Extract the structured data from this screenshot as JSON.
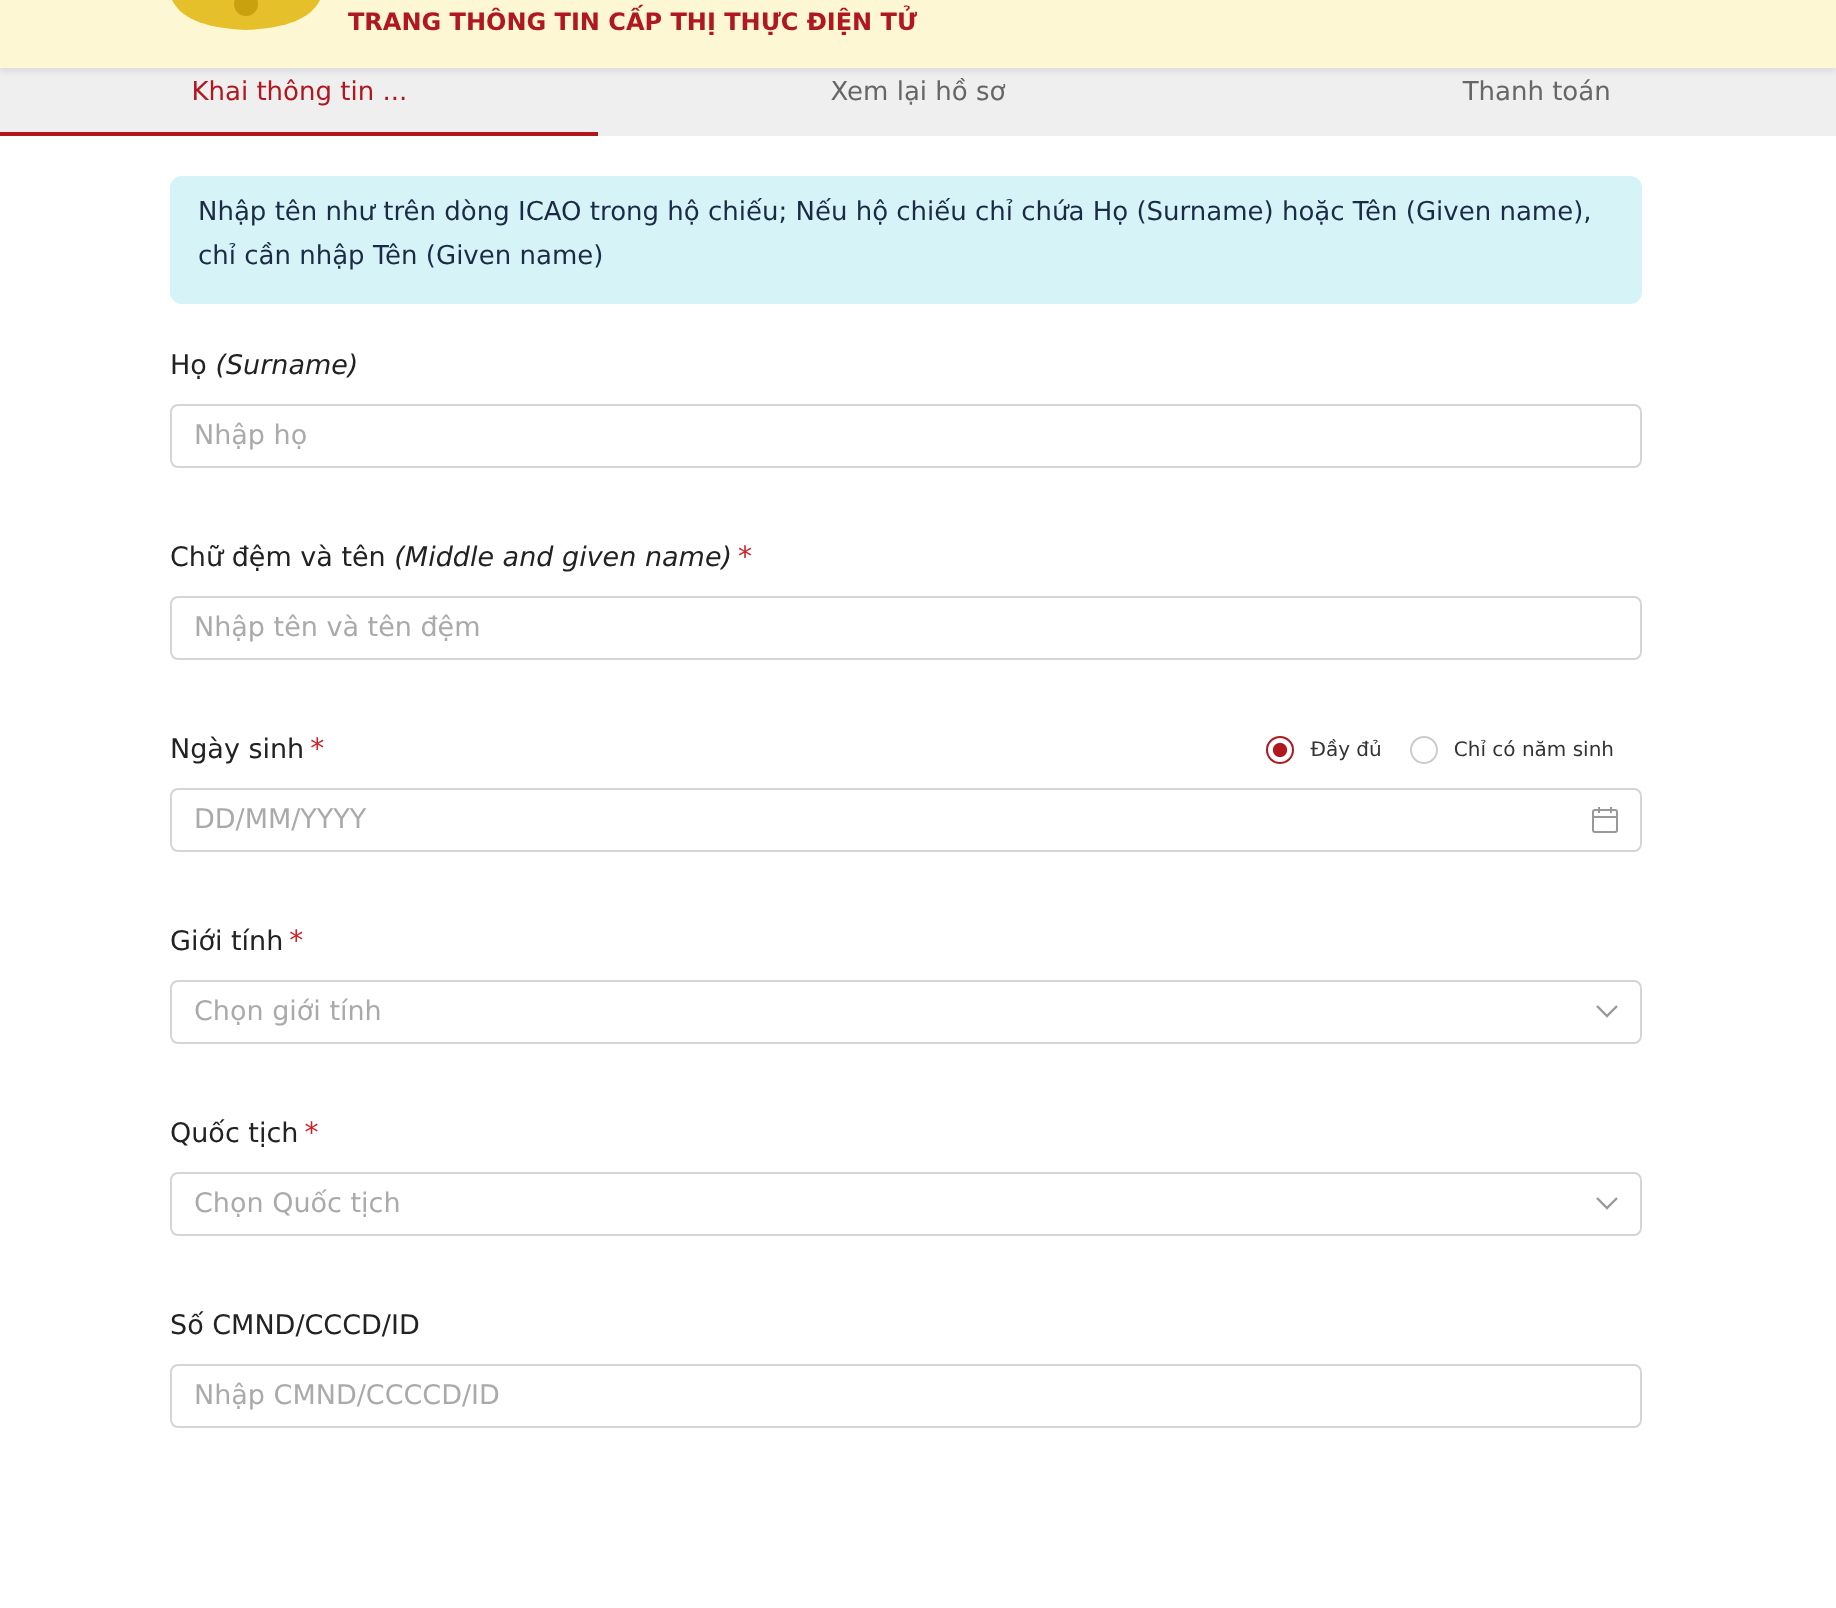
{
  "header": {
    "title": "TRANG THÔNG TIN CẤP THỊ THỰC ĐIỆN TỬ"
  },
  "tabs": [
    {
      "label": "Khai thông tin ...",
      "selected": true
    },
    {
      "label": "Xem lại hồ sơ",
      "selected": false
    },
    {
      "label": "Thanh toán",
      "selected": false
    }
  ],
  "notice": "Nhập tên như trên dòng ICAO trong hộ chiếu; Nếu hộ chiếu chỉ chứa Họ (Surname) hoặc Tên (Given name), chỉ cần nhập Tên (Given name)",
  "fields": [
    {
      "kind": "text",
      "label": "Họ *(Surname)*",
      "placeholder": "Nhập họ"
    },
    {
      "kind": "text",
      "label": "Chữ đệm và tên *(Middle and given name)*",
      "required_mark": "*",
      "placeholder": "Nhập tên và tên đệm"
    },
    {
      "kind": "date",
      "label": "Ngày sinh ",
      "required_mark": "*",
      "placeholder": "DD/MM/YYYY",
      "options": [
        {
          "label": "Đầy đủ",
          "selected": true
        },
        {
          "label": "Chỉ có năm sinh",
          "selected": false
        }
      ]
    },
    {
      "kind": "select",
      "label": "Giới tính",
      "required_mark": "*",
      "placeholder": "Chọn giới tính"
    },
    {
      "kind": "select",
      "label": "Quốc tịch",
      "required_mark": "*",
      "placeholder": "Chọn Quốc tịch"
    },
    {
      "kind": "text",
      "label": "Số CMND/CCCD/ID",
      "placeholder": "Nhập CMND/CCCCD/ID"
    }
  ]
}
